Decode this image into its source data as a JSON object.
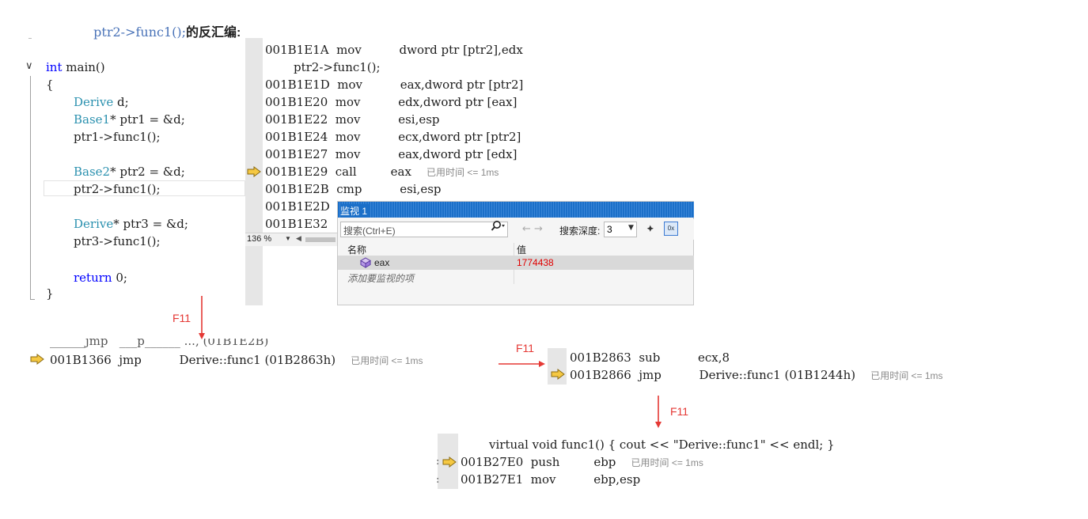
{
  "heading": {
    "code": "ptr2->func1();",
    "suffix": "的反汇编:"
  },
  "source": {
    "lines": [
      "int main()",
      "{",
      "Derive d;",
      "Base1* ptr1 = &d;",
      "ptr1->func1();",
      "Base2* ptr2 = &d;",
      "ptr2->func1();",
      "Derive* ptr3 = &d;",
      "ptr3->func1();",
      "return 0;",
      "}"
    ]
  },
  "disasm": {
    "rows": [
      {
        "addr": "001B1E1A",
        "op": "mov",
        "args": "dword ptr [ptr2],edx"
      },
      {
        "src": "ptr2->func1();"
      },
      {
        "addr": "001B1E1D",
        "op": "mov",
        "args": "eax,dword ptr [ptr2]"
      },
      {
        "addr": "001B1E20",
        "op": "mov",
        "args": "edx,dword ptr [eax]"
      },
      {
        "addr": "001B1E22",
        "op": "mov",
        "args": "esi,esp"
      },
      {
        "addr": "001B1E24",
        "op": "mov",
        "args": "ecx,dword ptr [ptr2]"
      },
      {
        "addr": "001B1E27",
        "op": "mov",
        "args": "eax,dword ptr [edx]"
      },
      {
        "addr": "001B1E29",
        "op": "call",
        "args": "eax",
        "elapsed": "已用时间 <= 1ms"
      },
      {
        "addr": "001B1E2B",
        "op": "cmp",
        "args": "esi,esp"
      },
      {
        "addr": "001B1E2D",
        "op": "",
        "args": ""
      },
      {
        "addr": "001B1E32",
        "op": "",
        "args": ""
      }
    ],
    "zoom": "136 %"
  },
  "watch": {
    "title": "监视 1",
    "search_placeholder": "搜索(Ctrl+E)",
    "depth_label": "搜索深度:",
    "depth_value": "3",
    "col_name": "名称",
    "col_value": "值",
    "item_name": "eax",
    "item_value": "1774438",
    "add_hint": "添加要监视的项"
  },
  "steps": {
    "label1": "F11",
    "label2": "F11",
    "label3": "F11"
  },
  "snip1": {
    "partial": "______jmp   ___p______ ..., (01B1E2B)",
    "addr": "001B1366",
    "op": "jmp",
    "args": "Derive::func1 (01B2863h)",
    "elapsed": "已用时间 <= 1ms"
  },
  "snip2": {
    "row1": {
      "addr": "001B2863",
      "op": "sub",
      "args": "ecx,8"
    },
    "row2": {
      "addr": "001B2866",
      "op": "jmp",
      "args": "Derive::func1 (01B1244h)"
    },
    "elapsed": "已用时间 <= 1ms"
  },
  "snip3": {
    "src": "virtual void func1() { cout << \"Derive::func1\" << endl; }",
    "row1": {
      "addr": "001B27E0",
      "op": "push",
      "args": "ebp"
    },
    "row2": {
      "addr": "001B27E1",
      "op": "mov",
      "args": "ebp,esp"
    },
    "elapsed": "已用时间 <= 1ms"
  },
  "colors": {
    "arrow_fill": "#f5c842",
    "arrow_stroke": "#8a6a10",
    "step_red": "#e53935",
    "value_red": "#e00000",
    "title_blue": "#1b6fc8"
  }
}
